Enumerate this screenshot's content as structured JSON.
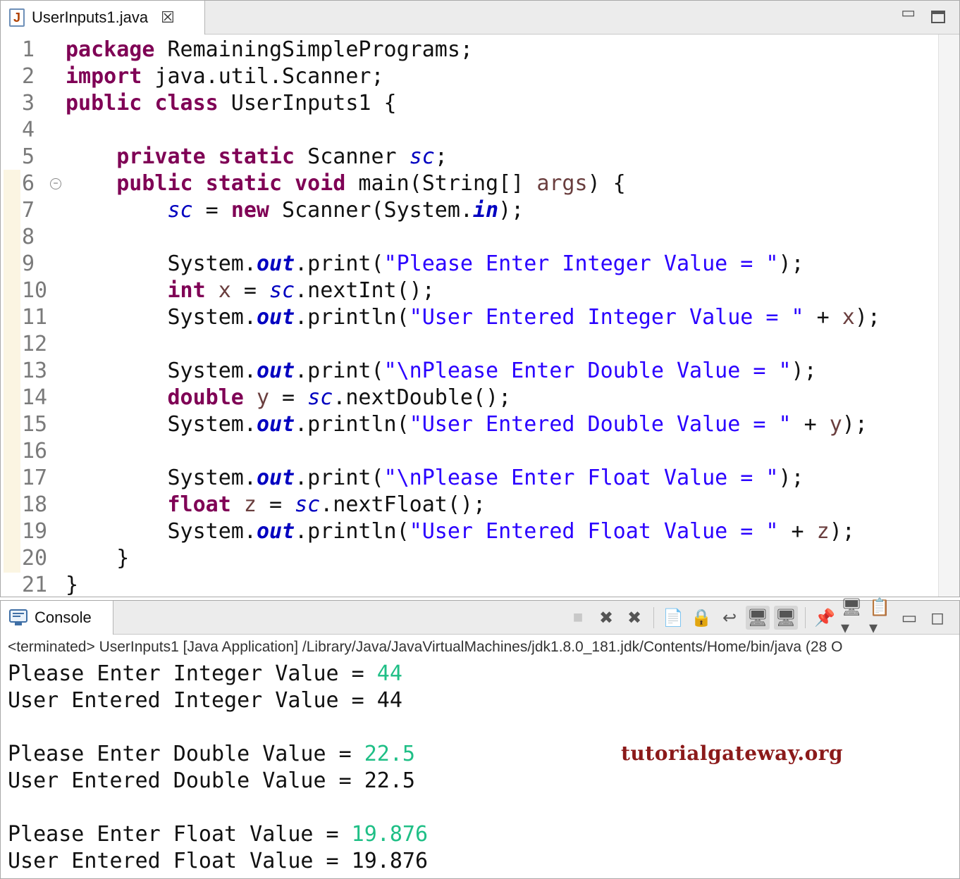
{
  "editor": {
    "tab_label": "UserInputs1.java",
    "tab_icon": "java-file-icon",
    "code_lines": [
      "1",
      "2",
      "3",
      "4",
      "5",
      "6",
      "7",
      "8",
      "9",
      "10",
      "11",
      "12",
      "13",
      "14",
      "15",
      "16",
      "17",
      "18",
      "19",
      "20",
      "21"
    ]
  },
  "console": {
    "tab_label": "Console",
    "status": "<terminated> UserInputs1 [Java Application] /Library/Java/JavaVirtualMachines/jdk1.8.0_181.jdk/Contents/Home/bin/java  (28 O",
    "output": [
      {
        "prompt": "Please Enter Integer Value = ",
        "input": "44"
      },
      {
        "text": "User Entered Integer Value = 44"
      },
      {
        "blank": true
      },
      {
        "prompt": "Please Enter Double Value = ",
        "input": "22.5"
      },
      {
        "text": "User Entered Double Value = 22.5"
      },
      {
        "blank": true
      },
      {
        "prompt": "Please Enter Float Value = ",
        "input": "19.876"
      },
      {
        "text": "User Entered Float Value = 19.876"
      }
    ],
    "toolbar_icons": [
      "terminate-icon",
      "remove-launch-icon",
      "remove-all-terminated-icon",
      "clear-console-icon",
      "scroll-lock-icon",
      "word-wrap-icon",
      "show-on-stdout-icon",
      "show-on-stderr-icon",
      "pin-console-icon",
      "display-console-icon",
      "open-console-icon",
      "minimize-icon",
      "maximize-icon"
    ],
    "input_color": "#1fbf86"
  },
  "watermark": "tutorialgateway.org",
  "colors": {
    "keyword": "#7f0055",
    "string": "#2a00ff",
    "field": "#0000c0",
    "variable": "#6a3e3e"
  }
}
